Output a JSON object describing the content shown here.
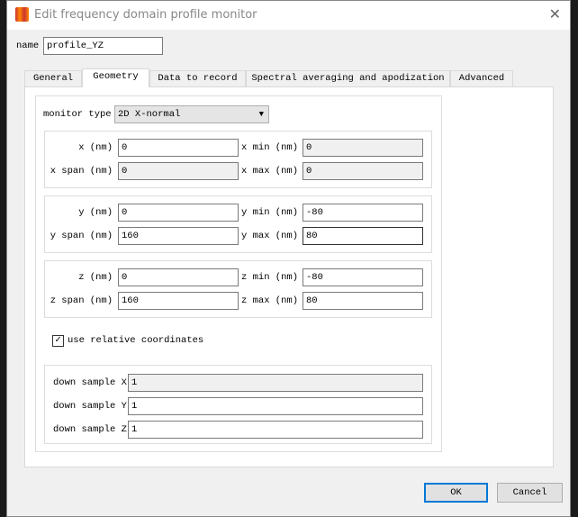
{
  "window": {
    "title": "Edit frequency domain profile monitor"
  },
  "name": {
    "label": "name",
    "value": "profile_YZ"
  },
  "tabs": [
    {
      "label": "General"
    },
    {
      "label": "Geometry"
    },
    {
      "label": "Data to record"
    },
    {
      "label": "Spectral averaging and apodization"
    },
    {
      "label": "Advanced"
    }
  ],
  "geometry": {
    "monitor_type": {
      "label": "monitor type",
      "value": "2D X-normal"
    },
    "x": {
      "center_label": "x (nm)",
      "center": "0",
      "span_label": "x span (nm)",
      "span": "0",
      "min_label": "x min (nm)",
      "min": "0",
      "max_label": "x max (nm)",
      "max": "0"
    },
    "y": {
      "center_label": "y (nm)",
      "center": "0",
      "span_label": "y span (nm)",
      "span": "160",
      "min_label": "y min (nm)",
      "min": "-80",
      "max_label": "y max (nm)",
      "max": "80"
    },
    "z": {
      "center_label": "z (nm)",
      "center": "0",
      "span_label": "z span (nm)",
      "span": "160",
      "min_label": "z min (nm)",
      "min": "-80",
      "max_label": "z max (nm)",
      "max": "80"
    },
    "relative": {
      "label": "use relative coordinates",
      "checked": true
    },
    "downsample": {
      "x_label": "down sample X",
      "x": "1",
      "y_label": "down sample Y",
      "y": "1",
      "z_label": "down sample Z",
      "z": "1"
    }
  },
  "buttons": {
    "ok": "OK",
    "cancel": "Cancel"
  }
}
